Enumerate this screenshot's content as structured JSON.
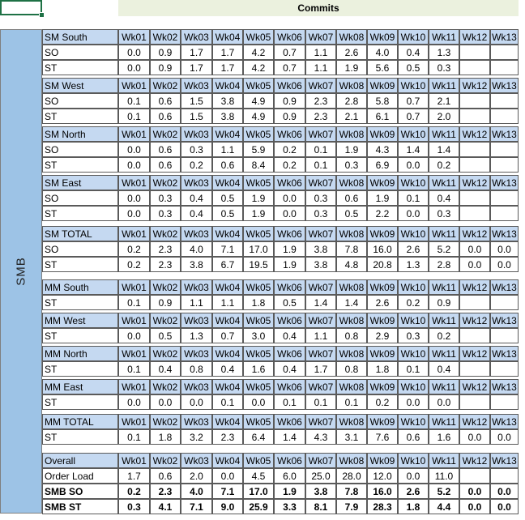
{
  "sheet": {
    "title": "Commits",
    "segment_label": "SMB",
    "weeks": [
      "Wk01",
      "Wk02",
      "Wk03",
      "Wk04",
      "Wk05",
      "Wk06",
      "Wk07",
      "Wk08",
      "Wk09",
      "Wk10",
      "Wk11",
      "Wk12",
      "Wk13"
    ],
    "blocks": [
      {
        "name": "SM South",
        "rows": [
          {
            "label": "SO",
            "values": [
              "0.0",
              "0.9",
              "1.7",
              "1.7",
              "4.2",
              "0.7",
              "1.1",
              "2.6",
              "4.0",
              "0.4",
              "1.3",
              "",
              ""
            ]
          },
          {
            "label": "ST",
            "values": [
              "0.0",
              "0.9",
              "1.7",
              "1.7",
              "4.2",
              "0.7",
              "1.1",
              "1.9",
              "5.6",
              "0.5",
              "0.3",
              "",
              ""
            ]
          }
        ]
      },
      {
        "name": "SM West",
        "rows": [
          {
            "label": "SO",
            "values": [
              "0.1",
              "0.6",
              "1.5",
              "3.8",
              "4.9",
              "0.9",
              "2.3",
              "2.8",
              "5.8",
              "0.7",
              "2.1",
              "",
              ""
            ]
          },
          {
            "label": "ST",
            "values": [
              "0.1",
              "0.6",
              "1.5",
              "3.8",
              "4.9",
              "0.9",
              "2.3",
              "2.1",
              "6.1",
              "0.7",
              "2.0",
              "",
              ""
            ]
          }
        ]
      },
      {
        "name": "SM North",
        "rows": [
          {
            "label": "SO",
            "values": [
              "0.0",
              "0.6",
              "0.3",
              "1.1",
              "5.9",
              "0.2",
              "0.1",
              "1.9",
              "4.3",
              "1.4",
              "1.4",
              "",
              ""
            ]
          },
          {
            "label": "ST",
            "values": [
              "0.0",
              "0.6",
              "0.2",
              "0.6",
              "8.4",
              "0.2",
              "0.1",
              "0.3",
              "6.9",
              "0.0",
              "0.2",
              "",
              ""
            ]
          }
        ]
      },
      {
        "name": "SM East",
        "rows": [
          {
            "label": "SO",
            "values": [
              "0.0",
              "0.3",
              "0.4",
              "0.5",
              "1.9",
              "0.0",
              "0.3",
              "0.6",
              "1.9",
              "0.1",
              "0.4",
              "",
              ""
            ]
          },
          {
            "label": "ST",
            "values": [
              "0.0",
              "0.3",
              "0.4",
              "0.5",
              "1.9",
              "0.0",
              "0.3",
              "0.5",
              "2.2",
              "0.0",
              "0.3",
              "",
              ""
            ]
          }
        ]
      },
      {
        "name": "SM TOTAL",
        "rows": [
          {
            "label": "SO",
            "values": [
              "0.2",
              "2.3",
              "4.0",
              "7.1",
              "17.0",
              "1.9",
              "3.8",
              "7.8",
              "16.0",
              "2.6",
              "5.2",
              "0.0",
              "0.0"
            ]
          },
          {
            "label": "ST",
            "values": [
              "0.2",
              "2.3",
              "3.8",
              "6.7",
              "19.5",
              "1.9",
              "3.8",
              "4.8",
              "20.8",
              "1.3",
              "2.8",
              "0.0",
              "0.0"
            ]
          }
        ]
      },
      {
        "name": "MM South",
        "rows": [
          {
            "label": "ST",
            "values": [
              "0.1",
              "0.9",
              "1.1",
              "1.1",
              "1.8",
              "0.5",
              "1.4",
              "1.4",
              "2.6",
              "0.2",
              "0.9",
              "",
              ""
            ]
          }
        ]
      },
      {
        "name": "MM West",
        "rows": [
          {
            "label": "ST",
            "values": [
              "0.0",
              "0.5",
              "1.3",
              "0.7",
              "3.0",
              "0.4",
              "1.1",
              "0.8",
              "2.9",
              "0.3",
              "0.2",
              "",
              ""
            ]
          }
        ]
      },
      {
        "name": "MM North",
        "rows": [
          {
            "label": "ST",
            "values": [
              "0.1",
              "0.4",
              "0.8",
              "0.4",
              "1.6",
              "0.4",
              "1.7",
              "0.8",
              "1.8",
              "0.1",
              "0.4",
              "",
              ""
            ]
          }
        ]
      },
      {
        "name": "MM East",
        "rows": [
          {
            "label": "ST",
            "values": [
              "0.0",
              "0.0",
              "0.0",
              "0.1",
              "0.0",
              "0.1",
              "0.1",
              "0.1",
              "0.2",
              "0.0",
              "0.0",
              "",
              ""
            ]
          }
        ]
      },
      {
        "name": "MM TOTAL",
        "rows": [
          {
            "label": "ST",
            "values": [
              "0.1",
              "1.8",
              "3.2",
              "2.3",
              "6.4",
              "1.4",
              "4.3",
              "3.1",
              "7.6",
              "0.6",
              "1.6",
              "0.0",
              "0.0"
            ]
          }
        ]
      },
      {
        "name": "Overall",
        "rows": [
          {
            "label": "Order Load",
            "bold": false,
            "values": [
              "1.7",
              "0.6",
              "2.0",
              "0.0",
              "4.5",
              "6.0",
              "25.0",
              "28.0",
              "12.0",
              "0.0",
              "11.0",
              "",
              ""
            ]
          },
          {
            "label": "SMB SO",
            "bold": true,
            "values": [
              "0.2",
              "2.3",
              "4.0",
              "7.1",
              "17.0",
              "1.9",
              "3.8",
              "7.8",
              "16.0",
              "2.6",
              "5.2",
              "0.0",
              "0.0"
            ]
          },
          {
            "label": "SMB ST",
            "bold": true,
            "values": [
              "0.3",
              "4.1",
              "7.1",
              "9.0",
              "25.9",
              "3.3",
              "8.1",
              "7.9",
              "28.3",
              "1.8",
              "4.4",
              "0.0",
              "0.0"
            ]
          }
        ]
      }
    ]
  }
}
